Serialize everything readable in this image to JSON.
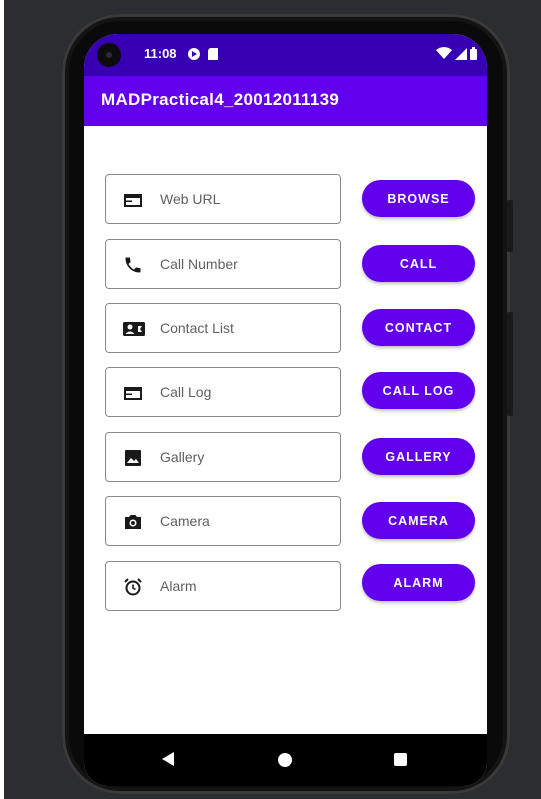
{
  "status_bar": {
    "time": "11:08",
    "background": "#3700b3"
  },
  "app_bar": {
    "title": "MADPractical4_20012011139",
    "background": "#6200ee"
  },
  "rows": [
    {
      "field": {
        "placeholder": "Web URL",
        "value": "",
        "icon": "web-icon"
      },
      "button": {
        "label": "BROWSE"
      }
    },
    {
      "field": {
        "placeholder": "Call Number",
        "value": "",
        "icon": "phone-icon"
      },
      "button": {
        "label": "CALL"
      }
    },
    {
      "field": {
        "placeholder": "Contact List",
        "value": "",
        "icon": "contact-card-icon"
      },
      "button": {
        "label": "CONTACT"
      }
    },
    {
      "field": {
        "placeholder": "Call Log",
        "value": "",
        "icon": "call-log-icon"
      },
      "button": {
        "label": "CALL LOG"
      }
    },
    {
      "field": {
        "placeholder": "Gallery",
        "value": "",
        "icon": "image-icon"
      },
      "button": {
        "label": "GALLERY"
      }
    },
    {
      "field": {
        "placeholder": "Camera",
        "value": "",
        "icon": "camera-icon"
      },
      "button": {
        "label": "CAMERA"
      }
    },
    {
      "field": {
        "placeholder": "Alarm",
        "value": "",
        "icon": "alarm-icon"
      },
      "button": {
        "label": "ALARM"
      }
    }
  ],
  "colors": {
    "accent": "#6200ee",
    "status": "#3700b3",
    "button_text": "#ffffff"
  },
  "nav_bar": {
    "back_icon": "back-triangle-icon",
    "home_icon": "home-circle-icon",
    "recent_icon": "recents-square-icon"
  }
}
